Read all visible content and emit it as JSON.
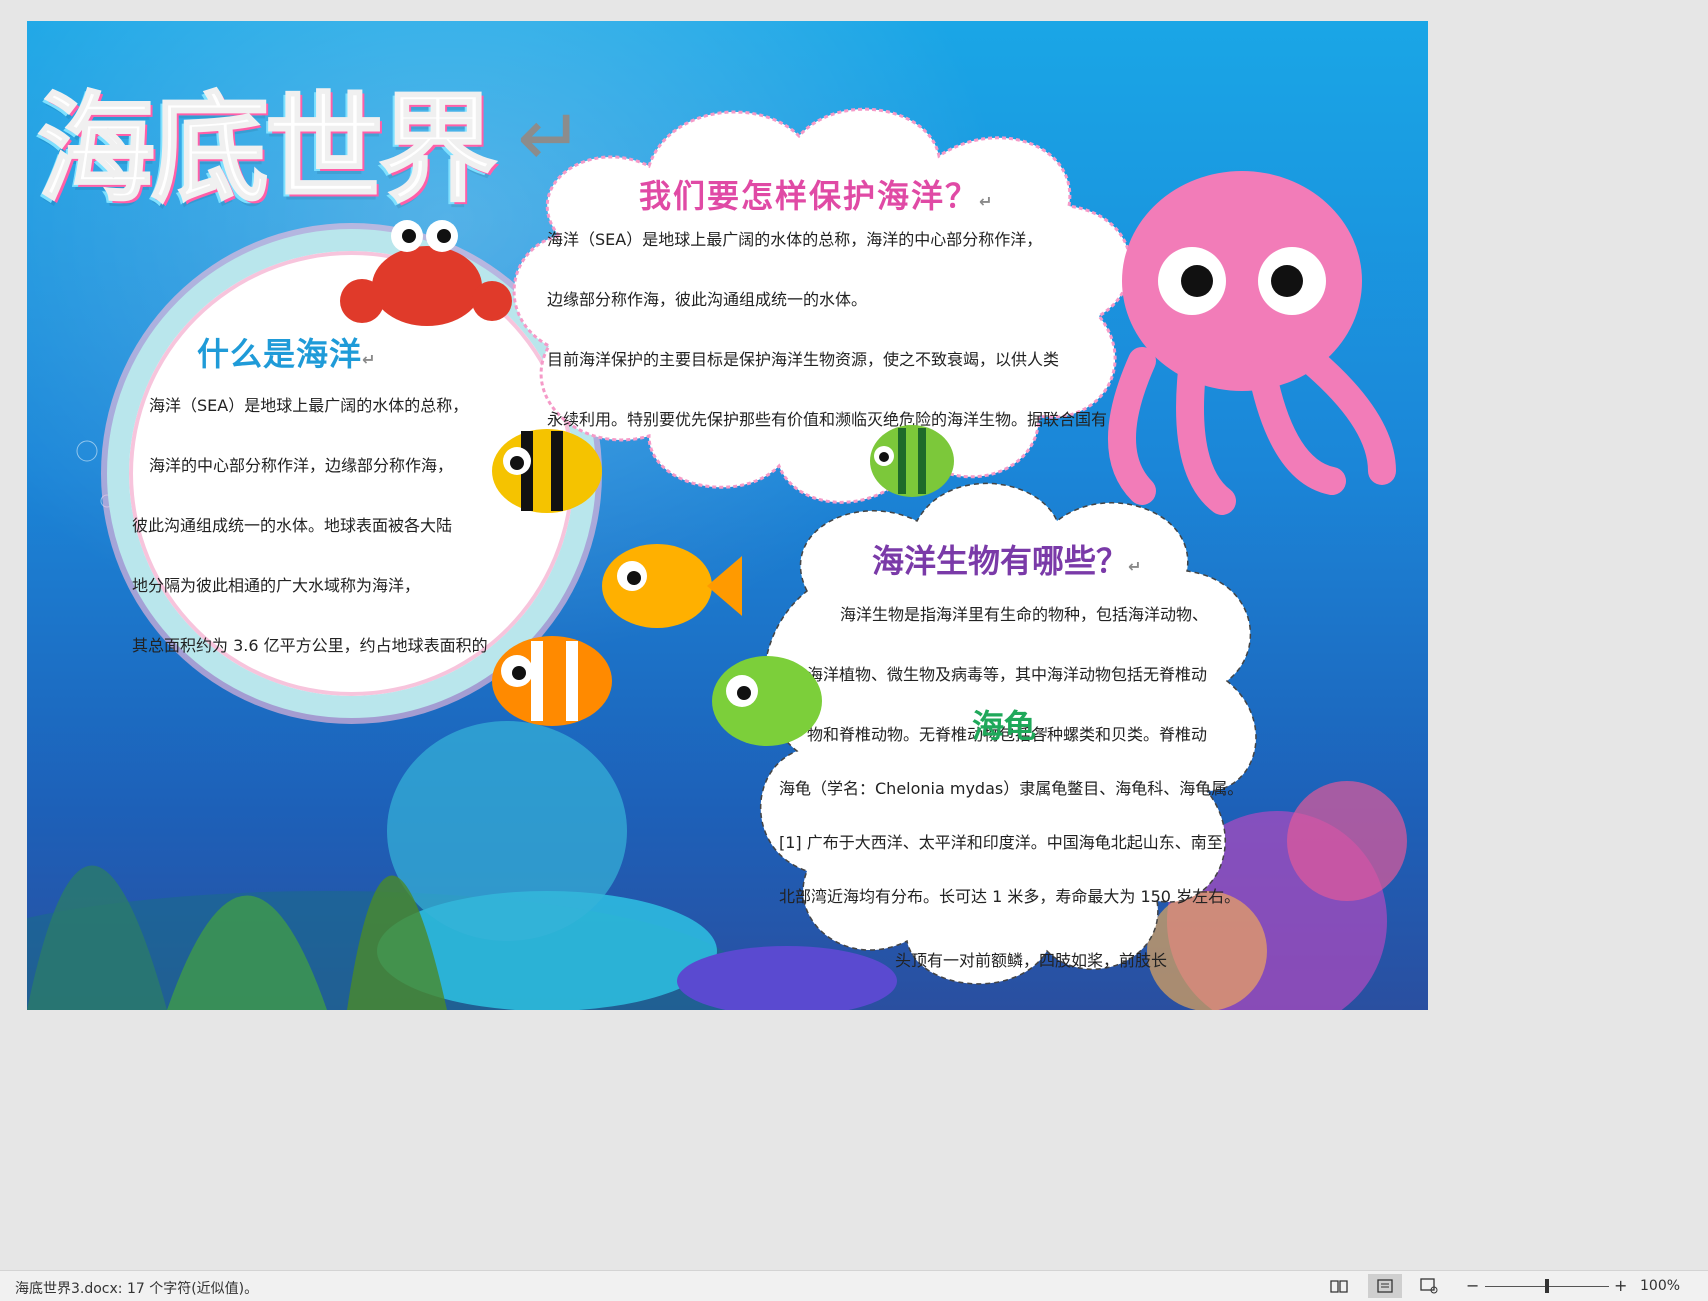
{
  "poster": {
    "title": "海底世界",
    "return_mark": "↵",
    "cloud": {
      "title": "我们要怎样保护海洋？",
      "lines": [
        "海洋（SEA）是地球上最广阔的水体的总称，海洋的中心部分称作洋，",
        "边缘部分称作海，彼此沟通组成统一的水体。",
        "目前海洋保护的主要目标是保护海洋生物资源，使之不致衰竭，以供人类",
        "永续利用。特别要优先保护那些有价值和濒临灭绝危险的海洋生物。据联合国有"
      ]
    },
    "circle": {
      "title": "什么是海洋",
      "lines": [
        "海洋（SEA）是地球上最广阔的水体的总称，",
        "海洋的中心部分称作洋，边缘部分称作海，",
        "彼此沟通组成统一的水体。地球表面被各大陆",
        "地分隔为彼此相通的广大水域称为海洋，",
        "其总面积约为 3.6 亿平方公里，约占地球表面积的"
      ]
    },
    "creatures": {
      "title": "海洋生物有哪些？",
      "lines": [
        "海洋生物是指海洋里有生命的物种，包括海洋动物、",
        "海洋植物、微生物及病毒等，其中海洋动物包括无脊椎动",
        "物和脊椎动物。无脊椎动物包括各种螺类和贝类。脊椎动"
      ]
    },
    "turtle": {
      "title": "海龟",
      "lines": [
        "海龟（学名：Chelonia mydas）隶属龟鳖目、海龟科、海龟属。",
        "[1]  广布于大西洋、太平洋和印度洋。中国海龟北起山东、南至",
        "北部湾近海均有分布。长可达 1 米多，寿命最大为 150 岁左右。",
        "头顶有一对前额鳞，四肢如桨，前肢长"
      ]
    }
  },
  "status_bar": {
    "doc_info": "海底世界3.docx: 17 个字符(近似值)。",
    "zoom_minus": "−",
    "zoom_plus": "+",
    "zoom_level": "100%"
  },
  "icons": [
    "read-mode-icon",
    "print-layout-icon",
    "web-layout-icon",
    "crab-icon",
    "octopus-icon",
    "fish-icon"
  ],
  "colors": {
    "cloud_title": "#e04aa5",
    "circle_title": "#1f9bd8",
    "creatures_title": "#7a3aa8",
    "turtle_title": "#1fa85a",
    "ocean": "#1b86d8"
  }
}
